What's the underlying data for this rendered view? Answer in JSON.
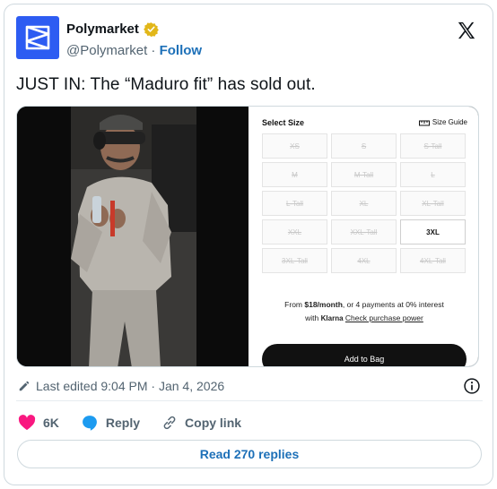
{
  "account": {
    "name": "Polymarket",
    "handle": "@Polymarket",
    "follow_label": "Follow"
  },
  "tweet": {
    "text": "JUST IN: The “Maduro fit” has sold out."
  },
  "shop": {
    "select_size_label": "Select Size",
    "size_guide_label": "Size Guide",
    "sizes": [
      {
        "label": "XS",
        "available": false
      },
      {
        "label": "S",
        "available": false
      },
      {
        "label": "S-Tall",
        "available": false
      },
      {
        "label": "M",
        "available": false
      },
      {
        "label": "M-Tall",
        "available": false
      },
      {
        "label": "L",
        "available": false
      },
      {
        "label": "L-Tall",
        "available": false
      },
      {
        "label": "XL",
        "available": false
      },
      {
        "label": "XL-Tall",
        "available": false
      },
      {
        "label": "XXL",
        "available": false
      },
      {
        "label": "XXL-Tall",
        "available": false
      },
      {
        "label": "3XL",
        "available": true
      },
      {
        "label": "3XL-Tall",
        "available": false
      },
      {
        "label": "4XL",
        "available": false
      },
      {
        "label": "4XL-Tall",
        "available": false
      }
    ],
    "finance_prefix": "From ",
    "finance_amount": "$18/month",
    "finance_suffix": ", or 4 payments at 0% interest",
    "finance_with": "with ",
    "finance_brand": "Klarna",
    "finance_link": "Check purchase power",
    "add_to_bag_label": "Add to Bag"
  },
  "footer": {
    "edited_text": "Last edited 9:04 PM · Jan 4, 2026",
    "like_count": "6K",
    "reply_label": "Reply",
    "copy_link_label": "Copy link",
    "read_replies_label": "Read 270 replies"
  },
  "colors": {
    "brand_blue": "#2d5cf2",
    "link_blue": "#1d70b8",
    "like_pink": "#f91880",
    "reply_blue": "#1d9bf0",
    "verified_gold": "#e2b719"
  }
}
